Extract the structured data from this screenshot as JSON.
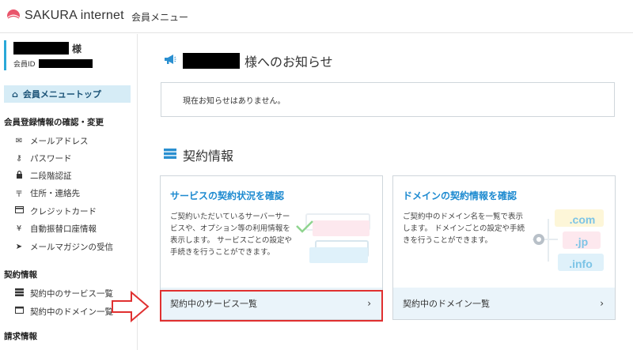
{
  "header": {
    "brand": "SAKURA internet",
    "menu_label": "会員メニュー"
  },
  "sidebar": {
    "user": {
      "suffix": "様",
      "id_label": "会員ID"
    },
    "top_item": "会員メニュートップ",
    "sections": [
      {
        "title": "会員登録情報の確認・変更",
        "items": [
          {
            "label": "メールアドレス",
            "icon": "envelope-icon"
          },
          {
            "label": "パスワード",
            "icon": "key-icon"
          },
          {
            "label": "二段階認証",
            "icon": "lock-icon"
          },
          {
            "label": "住所・連絡先",
            "icon": "postal-icon"
          },
          {
            "label": "クレジットカード",
            "icon": "credit-card-icon"
          },
          {
            "label": "自動振替口座情報",
            "icon": "yen-icon"
          },
          {
            "label": "メールマガジンの受信",
            "icon": "send-icon"
          }
        ]
      },
      {
        "title": "契約情報",
        "items": [
          {
            "label": "契約中のサービス一覧",
            "icon": "server-icon"
          },
          {
            "label": "契約中のドメイン一覧",
            "icon": "window-icon"
          }
        ]
      },
      {
        "title": "請求情報",
        "items": []
      }
    ]
  },
  "main": {
    "announce": {
      "title_suffix": "様へのお知らせ",
      "empty_message": "現在お知らせはありません。"
    },
    "contract": {
      "title": "契約情報",
      "cards": [
        {
          "title": "サービスの契約状況を確認",
          "desc": "ご契約いただいているサーバーサービスや、オプション等の利用情報を表示します。 サービスごとの設定や手続きを行うことができます。",
          "link": "契約中のサービス一覧"
        },
        {
          "title": "ドメインの契約情報を確認",
          "desc": "ご契約中のドメイン名を一覧で表示します。 ドメインごとの設定や手続きを行うことができます。",
          "link": "契約中のドメイン一覧",
          "tags": [
            ".com",
            ".jp",
            ".info"
          ]
        }
      ]
    }
  },
  "colors": {
    "accent": "#1d8ad0",
    "highlight": "#e03030",
    "nav_active": "#d6ecf6",
    "footer_bg": "#eaf4fa"
  }
}
